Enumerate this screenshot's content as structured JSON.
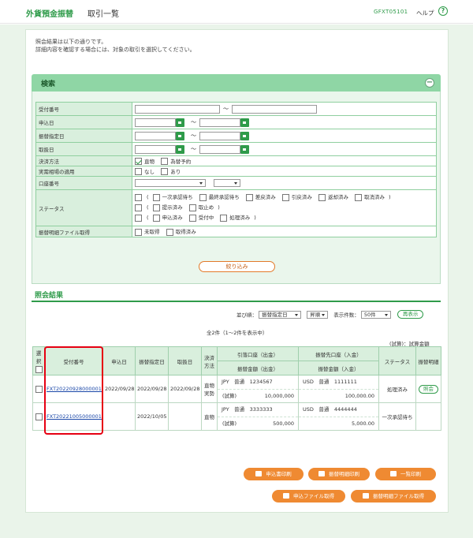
{
  "header": {
    "app_title": "外貨預金振替",
    "page_title": "取引一覧",
    "screen_id": "GFXT05101",
    "help_label": "ヘルプ",
    "help_icon": "?"
  },
  "intro": {
    "line1": "照会結果は以下の通りです。",
    "line2": "詳細内容を確認する場合には、対象の取引を選択してください。"
  },
  "search": {
    "title": "検索",
    "collapse_icon": "−",
    "labels": {
      "receipt_no": "受付番号",
      "apply_date": "申込日",
      "transfer_date": "振替指定日",
      "cancel_date": "取扱日",
      "settlement": "決済方法",
      "actual_demand": "実需相場の適用",
      "account_no": "口座番号",
      "status": "ステータス",
      "statement_file": "振替明細ファイル取得"
    },
    "tilde": "～",
    "settlement_options": [
      "直物",
      "為替予約"
    ],
    "actual_demand_options": [
      "なし",
      "あり"
    ],
    "status_rows": [
      [
        "一次承認待ち",
        "最終承認待ち",
        "差戻済み",
        "引戻済み",
        "返却済み",
        "取消済み"
      ],
      [
        "提示済み",
        "取止め"
      ],
      [
        "申込済み",
        "受付中",
        "処理済み"
      ]
    ],
    "paren_open": "(",
    "paren_close": ")",
    "statement_options": [
      "未取得",
      "取得済み"
    ],
    "submit_label": "絞り込み"
  },
  "results": {
    "title": "照会結果",
    "sort_label": "並び順：",
    "sort_value": "振替指定日",
    "order_value": "昇順",
    "per_page_label": "表示件数：",
    "per_page_value": "50件",
    "redisplay_label": "再表示",
    "count_text": "全2件（1～2件を表示中）",
    "trial_note": "(試算)：試算金額",
    "columns": {
      "select": "選択",
      "receipt_no": "受付番号",
      "apply_date": "申込日",
      "transfer_date": "振替指定日",
      "handled_date": "取扱日",
      "settlement": "決済方法",
      "debit_account": "引落口座（出金）",
      "debit_amount": "振替金額（出金）",
      "credit_account": "振替先口座（入金）",
      "credit_amount": "振替金額（入金）",
      "status": "ステータス",
      "statement": "振替明細"
    },
    "rows": [
      {
        "receipt_no": "FXT20220928000001",
        "apply_date": "2022/09/28",
        "transfer_date": "2022/09/28",
        "handled_date": "2022/09/28",
        "settlement": "直物実勢",
        "debit_account": "JPY　普通　1234567",
        "debit_label": "(試算)",
        "debit_amount": "10,000,000",
        "credit_account": "USD　普通　1111111",
        "credit_label": "",
        "credit_amount": "100,000.00",
        "status": "処理済み",
        "statement": "照会"
      },
      {
        "receipt_no": "FXT20221005000001",
        "apply_date": "",
        "transfer_date": "2022/10/05",
        "handled_date": "",
        "settlement": "直物",
        "debit_account": "JPY　普通　3333333",
        "debit_label": "(試算)",
        "debit_amount": "500,000",
        "credit_account": "USD　普通　4444444",
        "credit_label": "",
        "credit_amount": "5,000.00",
        "status": "一次承認待ち",
        "statement": ""
      }
    ]
  },
  "footer_buttons": {
    "print_application": "申込書印刷",
    "print_statement": "振替明細印刷",
    "print_list": "一覧印刷",
    "get_application_file": "申込ファイル取得",
    "get_statement_file": "振替明細ファイル取得"
  },
  "colors": {
    "brand_green": "#2f9b4a",
    "accent_orange": "#ef8a32",
    "highlight_red": "#e60012"
  }
}
